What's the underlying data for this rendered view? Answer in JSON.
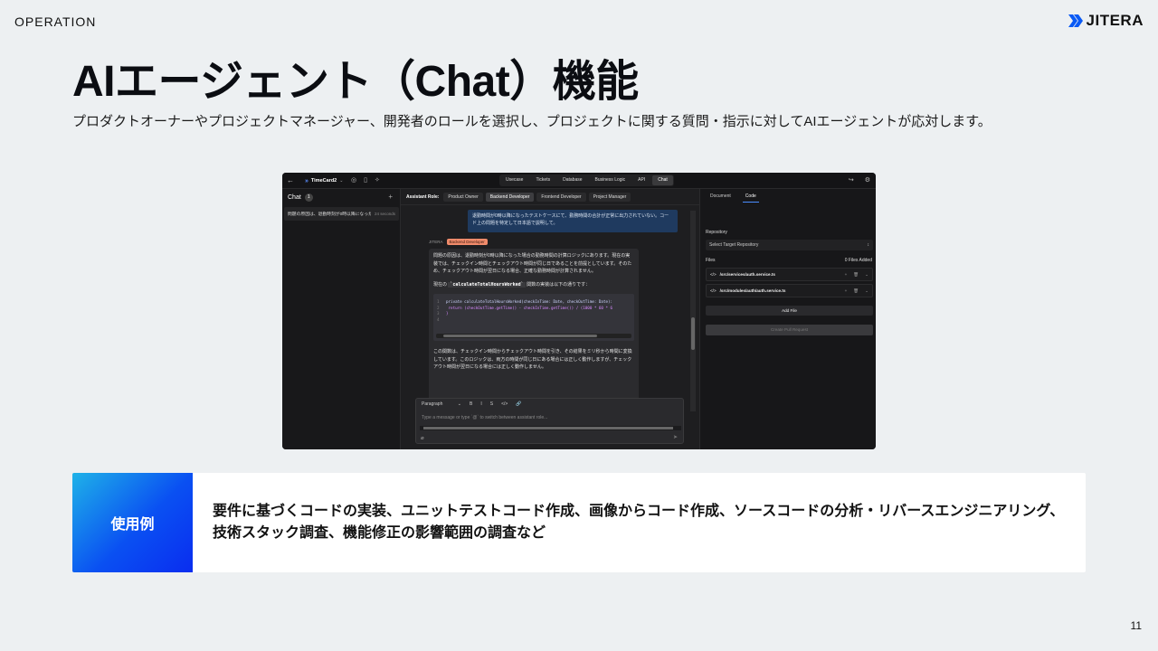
{
  "header": {
    "section": "OPERATION",
    "logo_text": "JITERA",
    "title": "AIエージェント（Chat）機能",
    "subtitle": "プロダクトオーナーやプロジェクトマネージャー、開発者のロールを選択し、プロジェクトに関する質問・指示に対してAIエージェントが応対します。"
  },
  "screenshot": {
    "topbar": {
      "back_icon": "←",
      "project_name": "TimeCard2",
      "tabs": [
        {
          "label": "Usecase",
          "active": false
        },
        {
          "label": "Tickets",
          "active": false
        },
        {
          "label": "Database",
          "active": false
        },
        {
          "label": "Business Logic",
          "active": false
        },
        {
          "label": "API",
          "active": false
        },
        {
          "label": "Chat",
          "active": true
        }
      ]
    },
    "sidebar": {
      "title": "Chat",
      "count": "1",
      "add_icon": "+",
      "items": [
        {
          "text": "問題の原因は、退勤時刻が0時以降になった...",
          "time": "24 seconds"
        }
      ]
    },
    "chat": {
      "role_label": "Assistant Role:",
      "roles": [
        {
          "label": "Product Owner",
          "active": false
        },
        {
          "label": "Backend Developer",
          "active": true
        },
        {
          "label": "Frontend Developer",
          "active": false
        },
        {
          "label": "Project Manager",
          "active": false
        }
      ],
      "user_message": "退勤時間が0時以降になったテストケースにて、勤務時間の合計が正常に出力されていない。コード上の問題を特定して日本語で説明して。",
      "bot_name": "JITERA",
      "bot_badge": "Backend Developer",
      "bot_para1": "問題の原因は、退勤時刻が0時以降になった場合の勤務時間の計算ロジックにあります。現在の実装では、チェックイン時間とチェックアウト時間が同じ日であることを前提としています。そのため、チェックアウト時間が翌日になる場合、正確な勤務時間が計算されません。",
      "bot_para2_prefix": "現在の",
      "bot_para2_code": "`calculateTotalHoursWorked`",
      "bot_para2_suffix": "関数の実装は以下の通りです：",
      "code_lines": [
        {
          "n": "1",
          "text": "private calculateTotalHoursWorked(checkInTime: Date, checkOutTime: Date):"
        },
        {
          "n": "2",
          "text": "  return (checkOutTime.getTime() - checkInTime.getTime()) / (1000 * 60 * 6"
        },
        {
          "n": "3",
          "text": "}"
        },
        {
          "n": "4",
          "text": ""
        }
      ],
      "bot_para3": "この関数は、チェックイン時間からチェックアウト時間を引き、その結果をミリ秒から時間に変換しています。このロジックは、両方の時間が同じ日にある場合には正しく動作しますが、チェックアウト時間が翌日になる場合には正しく動作しません。",
      "composer": {
        "format": "Paragraph",
        "tools": [
          "B",
          "I",
          "S",
          "</>",
          "🔗"
        ],
        "placeholder": "Type a message or type `@` to switch between assistant role..."
      }
    },
    "right_panel": {
      "tabs": [
        {
          "label": "Document",
          "active": false
        },
        {
          "label": "Code",
          "active": true
        }
      ],
      "repository_label": "Repository",
      "repository_placeholder": "Select Target Repository",
      "files_label": "Files",
      "files_added": "0 Files Added",
      "files": [
        {
          "path": "/src/services/auth.service.ts"
        },
        {
          "path": "/src/modules/auth/auth.service.ts"
        }
      ],
      "add_file": "Add File",
      "create_pr": "Create Pull Request"
    }
  },
  "usecase": {
    "label": "使用例",
    "text": "要件に基づくコードの実装、ユニットテストコード作成、画像からコード作成、ソースコードの分析・リバースエンジニアリング、技術スタック調査、機能修正の影響範囲の調査など"
  },
  "page_number": "11",
  "colors": {
    "background": "#edf0f2",
    "brand_blue": "#0a50f2",
    "gradient_start": "#1fb2e8",
    "badge_orange": "#f08b6b"
  }
}
